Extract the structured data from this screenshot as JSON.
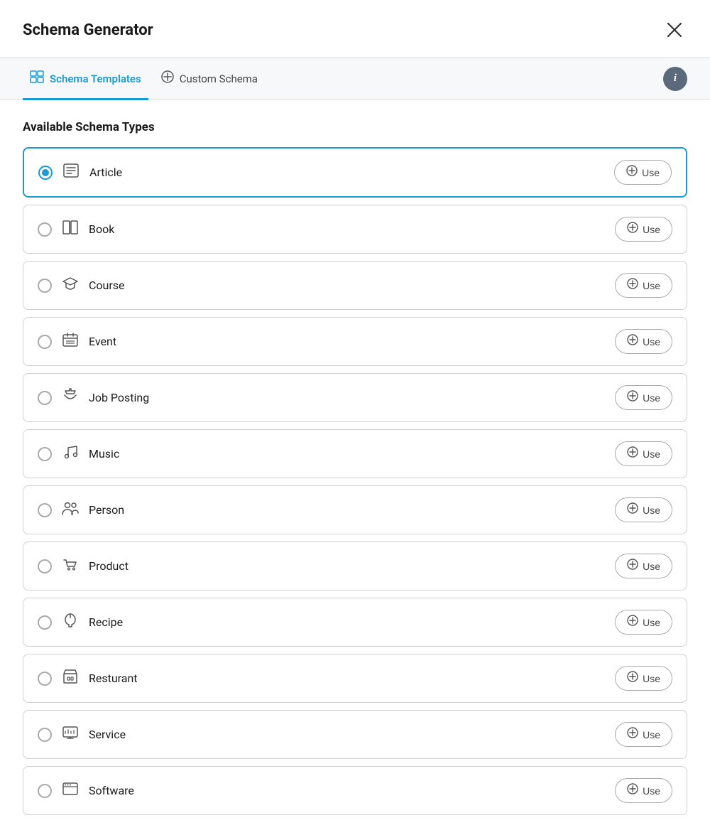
{
  "header": {
    "title": "Schema Generator",
    "close_label": "✕"
  },
  "tabs": [
    {
      "id": "schema-templates",
      "label": "Schema Templates",
      "icon": "⊞",
      "active": true
    },
    {
      "id": "custom-schema",
      "label": "Custom Schema",
      "icon": "⊕",
      "active": false
    }
  ],
  "info_button_label": "i",
  "section_title": "Available Schema Types",
  "schema_types": [
    {
      "id": "article",
      "label": "Article",
      "icon": "📄",
      "selected": true
    },
    {
      "id": "book",
      "label": "Book",
      "icon": "📖",
      "selected": false
    },
    {
      "id": "course",
      "label": "Course",
      "icon": "🎓",
      "selected": false
    },
    {
      "id": "event",
      "label": "Event",
      "icon": "📅",
      "selected": false
    },
    {
      "id": "job-posting",
      "label": "Job Posting",
      "icon": "📢",
      "selected": false
    },
    {
      "id": "music",
      "label": "Music",
      "icon": "🎵",
      "selected": false
    },
    {
      "id": "person",
      "label": "Person",
      "icon": "👥",
      "selected": false
    },
    {
      "id": "product",
      "label": "Product",
      "icon": "🛒",
      "selected": false
    },
    {
      "id": "recipe",
      "label": "Recipe",
      "icon": "🍳",
      "selected": false
    },
    {
      "id": "resturant",
      "label": "Resturant",
      "icon": "🏪",
      "selected": false
    },
    {
      "id": "service",
      "label": "Service",
      "icon": "🖥",
      "selected": false
    },
    {
      "id": "software",
      "label": "Software",
      "icon": "💻",
      "selected": false
    }
  ],
  "use_label": "Use"
}
